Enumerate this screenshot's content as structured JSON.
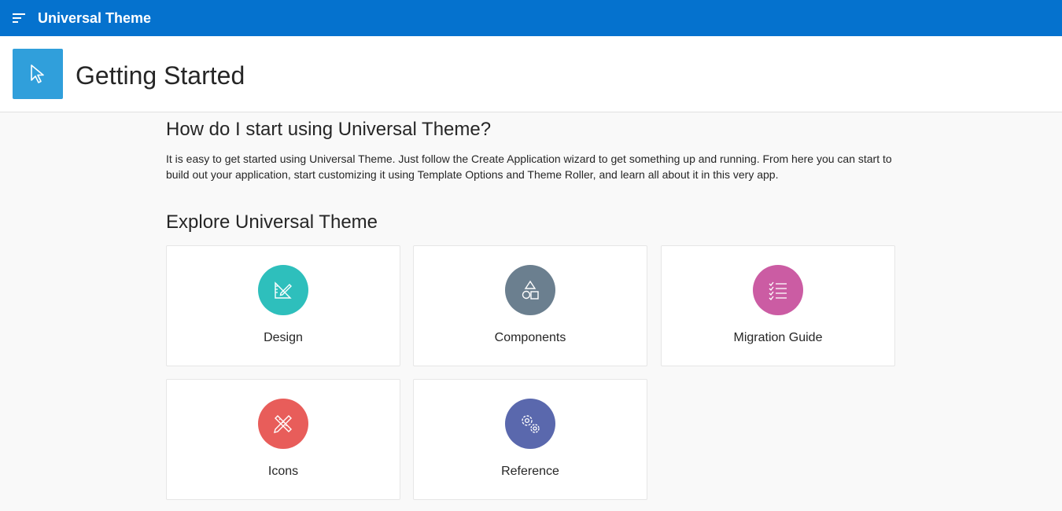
{
  "header": {
    "app_title": "Universal Theme",
    "menu_icon": "hamburger-icon",
    "accent": "#0572ce"
  },
  "hero": {
    "title": "Getting Started",
    "icon": "pointer-icon",
    "icon_bg": "#309fdb"
  },
  "intro": {
    "heading": "How do I start using Universal Theme?",
    "text": "It is easy to get started using Universal Theme. Just follow the Create Application wizard to get something up and running. From here you can start to build out your application, start customizing it using Template Options and Theme Roller, and learn all about it in this very app."
  },
  "explore": {
    "heading": "Explore Universal Theme",
    "cards": [
      {
        "label": "Design",
        "icon": "ruler-pencil-icon",
        "color": "#2ebfbc"
      },
      {
        "label": "Components",
        "icon": "shapes-icon",
        "color": "#6b7f8f"
      },
      {
        "label": "Migration Guide",
        "icon": "checklist-icon",
        "color": "#cb5ca3"
      },
      {
        "label": "Icons",
        "icon": "pencil-ruler-cross-icon",
        "color": "#e85d5a"
      },
      {
        "label": "Reference",
        "icon": "gears-icon",
        "color": "#5a68ad"
      }
    ]
  }
}
